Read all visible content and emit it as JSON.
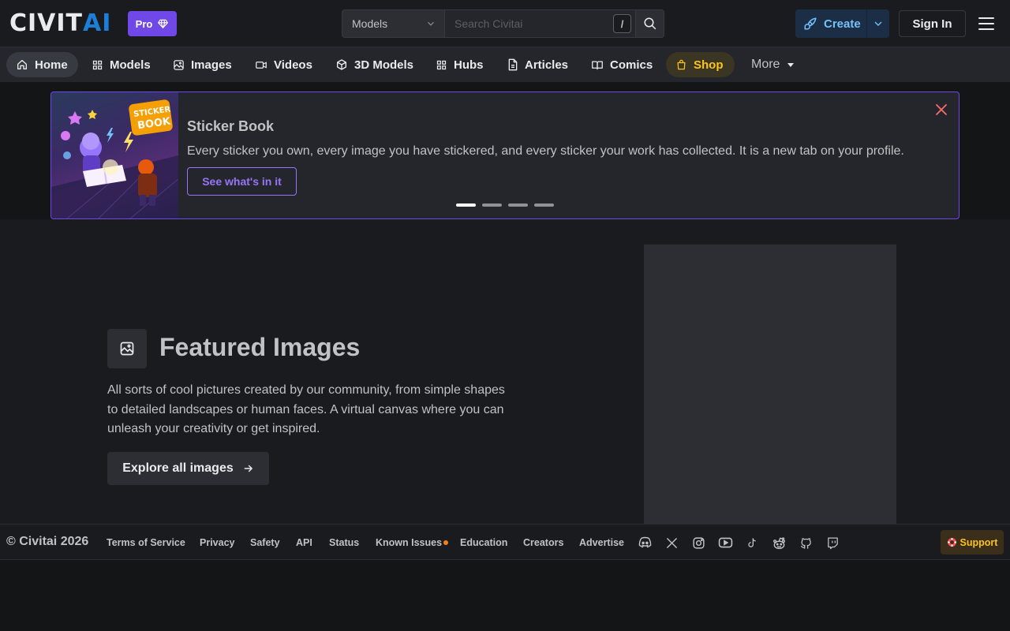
{
  "header": {
    "logo": {
      "part1": "CIVIT",
      "part2": "AI"
    },
    "pro_label": "Pro",
    "search": {
      "category": "Models",
      "placeholder": "Search Civitai",
      "shortcut": "/"
    },
    "create_label": "Create",
    "signin_label": "Sign In"
  },
  "nav": {
    "items": [
      {
        "label": "Home",
        "icon": "home-icon"
      },
      {
        "label": "Models",
        "icon": "grid-icon"
      },
      {
        "label": "Images",
        "icon": "image-icon"
      },
      {
        "label": "Videos",
        "icon": "video-icon"
      },
      {
        "label": "3D Models",
        "icon": "cube-icon"
      },
      {
        "label": "Hubs",
        "icon": "grid-icon"
      },
      {
        "label": "Articles",
        "icon": "file-icon"
      },
      {
        "label": "Comics",
        "icon": "book-icon"
      },
      {
        "label": "Shop",
        "icon": "shopping-bag-icon"
      }
    ],
    "more_label": "More"
  },
  "banner": {
    "title": "Sticker Book",
    "text": "Every sticker you own, every image you have stickered, and every sticker your work has collected. It is a new tab on your profile.",
    "button": "See what's in it",
    "image_text_1": "STICKER",
    "image_text_2": "BOOK",
    "slides": 4,
    "active_slide": 1
  },
  "featured": {
    "title": "Featured Images",
    "description": "All sorts of cool pictures created by our community, from simple shapes to detailed landscapes or human faces. A virtual canvas where you can unleash your creativity or get inspired.",
    "button": "Explore all images"
  },
  "footer": {
    "copyright": "© Civitai 2026",
    "links": [
      "Terms of Service",
      "Privacy",
      "Safety",
      "API",
      "Status",
      "Known Issues",
      "Education",
      "Creators",
      "Advertise"
    ],
    "socials": [
      "discord-icon",
      "x-icon",
      "instagram-icon",
      "youtube-icon",
      "tiktok-icon",
      "reddit-icon",
      "github-icon",
      "twitch-icon"
    ],
    "support_label": "Support"
  },
  "colors": {
    "background": "#1a1b1e",
    "accent_purple": "#7048e8",
    "accent_blue": "#1c7ed6",
    "shop_yellow": "#fcc419",
    "status_orange": "#fd7e14"
  }
}
